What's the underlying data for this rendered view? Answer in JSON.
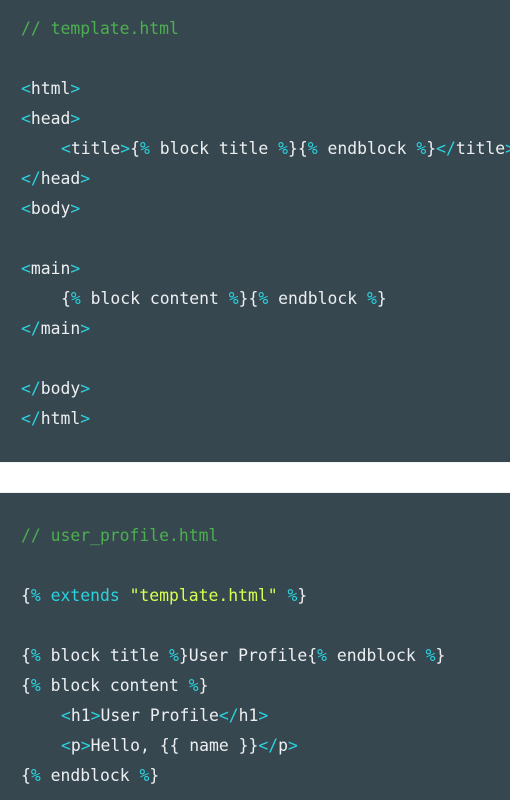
{
  "panels": [
    {
      "file_comment": "// template.html",
      "lines": [
        {
          "indent": false,
          "tokens": [
            {
              "t": "// template.html",
              "c": "comment"
            }
          ]
        },
        {
          "indent": false,
          "tokens": []
        },
        {
          "indent": false,
          "tokens": [
            {
              "t": "<",
              "c": "punct"
            },
            {
              "t": "html",
              "c": "tag"
            },
            {
              "t": ">",
              "c": "punct"
            }
          ]
        },
        {
          "indent": false,
          "tokens": [
            {
              "t": "<",
              "c": "punct"
            },
            {
              "t": "head",
              "c": "tag"
            },
            {
              "t": ">",
              "c": "punct"
            }
          ]
        },
        {
          "indent": true,
          "tokens": [
            {
              "t": "<",
              "c": "punct"
            },
            {
              "t": "title",
              "c": "tag"
            },
            {
              "t": ">",
              "c": "punct"
            },
            {
              "t": "{",
              "c": "text"
            },
            {
              "t": "%",
              "c": "tmpl"
            },
            {
              "t": " block title ",
              "c": "kw"
            },
            {
              "t": "%",
              "c": "tmpl"
            },
            {
              "t": "}",
              "c": "text"
            },
            {
              "t": "{",
              "c": "text"
            },
            {
              "t": "%",
              "c": "tmpl"
            },
            {
              "t": " endblock ",
              "c": "kw"
            },
            {
              "t": "%",
              "c": "tmpl"
            },
            {
              "t": "}",
              "c": "text"
            },
            {
              "t": "</",
              "c": "punct"
            },
            {
              "t": "title",
              "c": "tag"
            },
            {
              "t": ">",
              "c": "punct"
            }
          ]
        },
        {
          "indent": false,
          "tokens": [
            {
              "t": "</",
              "c": "punct"
            },
            {
              "t": "head",
              "c": "tag"
            },
            {
              "t": ">",
              "c": "punct"
            }
          ]
        },
        {
          "indent": false,
          "tokens": [
            {
              "t": "<",
              "c": "punct"
            },
            {
              "t": "body",
              "c": "tag"
            },
            {
              "t": ">",
              "c": "punct"
            }
          ]
        },
        {
          "indent": false,
          "tokens": []
        },
        {
          "indent": false,
          "tokens": [
            {
              "t": "<",
              "c": "punct"
            },
            {
              "t": "main",
              "c": "tag"
            },
            {
              "t": ">",
              "c": "punct"
            }
          ]
        },
        {
          "indent": true,
          "tokens": [
            {
              "t": "{",
              "c": "text"
            },
            {
              "t": "%",
              "c": "tmpl"
            },
            {
              "t": " block content ",
              "c": "kw"
            },
            {
              "t": "%",
              "c": "tmpl"
            },
            {
              "t": "}",
              "c": "text"
            },
            {
              "t": "{",
              "c": "text"
            },
            {
              "t": "%",
              "c": "tmpl"
            },
            {
              "t": " endblock ",
              "c": "kw"
            },
            {
              "t": "%",
              "c": "tmpl"
            },
            {
              "t": "}",
              "c": "text"
            }
          ]
        },
        {
          "indent": false,
          "tokens": [
            {
              "t": "</",
              "c": "punct"
            },
            {
              "t": "main",
              "c": "tag"
            },
            {
              "t": ">",
              "c": "punct"
            }
          ]
        },
        {
          "indent": false,
          "tokens": []
        },
        {
          "indent": false,
          "tokens": [
            {
              "t": "</",
              "c": "punct"
            },
            {
              "t": "body",
              "c": "tag"
            },
            {
              "t": ">",
              "c": "punct"
            }
          ]
        },
        {
          "indent": false,
          "tokens": [
            {
              "t": "</",
              "c": "punct"
            },
            {
              "t": "html",
              "c": "tag"
            },
            {
              "t": ">",
              "c": "punct"
            }
          ]
        }
      ]
    },
    {
      "file_comment": "// user_profile.html",
      "lines": [
        {
          "indent": false,
          "tokens": [
            {
              "t": "// user_profile.html",
              "c": "comment"
            }
          ]
        },
        {
          "indent": false,
          "tokens": []
        },
        {
          "indent": false,
          "tokens": [
            {
              "t": "{",
              "c": "text"
            },
            {
              "t": "%",
              "c": "tmpl"
            },
            {
              "t": " extends ",
              "c": "tmpl"
            },
            {
              "t": "\"template.html\"",
              "c": "str"
            },
            {
              "t": " ",
              "c": "text"
            },
            {
              "t": "%",
              "c": "tmpl"
            },
            {
              "t": "}",
              "c": "text"
            }
          ]
        },
        {
          "indent": false,
          "tokens": []
        },
        {
          "indent": false,
          "tokens": [
            {
              "t": "{",
              "c": "text"
            },
            {
              "t": "%",
              "c": "tmpl"
            },
            {
              "t": " block title ",
              "c": "kw"
            },
            {
              "t": "%",
              "c": "tmpl"
            },
            {
              "t": "}",
              "c": "text"
            },
            {
              "t": "User Profile",
              "c": "text"
            },
            {
              "t": "{",
              "c": "text"
            },
            {
              "t": "%",
              "c": "tmpl"
            },
            {
              "t": " endblock ",
              "c": "kw"
            },
            {
              "t": "%",
              "c": "tmpl"
            },
            {
              "t": "}",
              "c": "text"
            }
          ]
        },
        {
          "indent": false,
          "tokens": [
            {
              "t": "{",
              "c": "text"
            },
            {
              "t": "%",
              "c": "tmpl"
            },
            {
              "t": " block content ",
              "c": "kw"
            },
            {
              "t": "%",
              "c": "tmpl"
            },
            {
              "t": "}",
              "c": "text"
            }
          ]
        },
        {
          "indent": true,
          "tokens": [
            {
              "t": "<",
              "c": "punct"
            },
            {
              "t": "h1",
              "c": "tag"
            },
            {
              "t": ">",
              "c": "punct"
            },
            {
              "t": "User Profile",
              "c": "text"
            },
            {
              "t": "</",
              "c": "punct"
            },
            {
              "t": "h1",
              "c": "tag"
            },
            {
              "t": ">",
              "c": "punct"
            }
          ]
        },
        {
          "indent": true,
          "tokens": [
            {
              "t": "<",
              "c": "punct"
            },
            {
              "t": "p",
              "c": "tag"
            },
            {
              "t": ">",
              "c": "punct"
            },
            {
              "t": "Hello, {{ name }}",
              "c": "text"
            },
            {
              "t": "</",
              "c": "punct"
            },
            {
              "t": "p",
              "c": "tag"
            },
            {
              "t": ">",
              "c": "punct"
            }
          ]
        },
        {
          "indent": false,
          "tokens": [
            {
              "t": "{",
              "c": "text"
            },
            {
              "t": "%",
              "c": "tmpl"
            },
            {
              "t": " endblock ",
              "c": "kw"
            },
            {
              "t": "%",
              "c": "tmpl"
            },
            {
              "t": "}",
              "c": "text"
            }
          ]
        }
      ]
    }
  ],
  "colors": {
    "panel_bg": "#37474f",
    "comment": "#4caf50",
    "punct": "#29d3e0",
    "text": "#eceff1",
    "string": "#d7ff4f"
  }
}
